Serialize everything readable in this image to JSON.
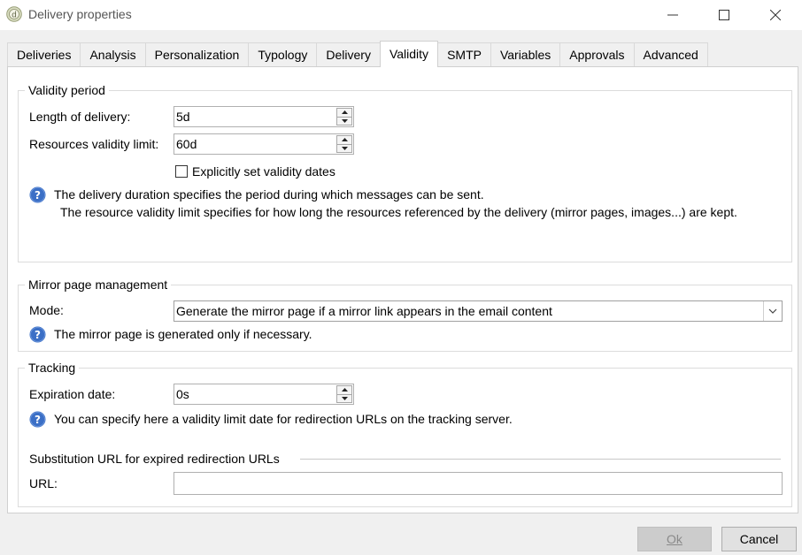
{
  "window": {
    "title": "Delivery properties",
    "app_icon": "delivery-app-icon",
    "controls": [
      "minimize-icon",
      "maximize-icon",
      "close-icon"
    ]
  },
  "tabs": [
    {
      "label": "Deliveries"
    },
    {
      "label": "Analysis"
    },
    {
      "label": "Personalization"
    },
    {
      "label": "Typology"
    },
    {
      "label": "Delivery"
    },
    {
      "label": "Validity",
      "active": true
    },
    {
      "label": "SMTP"
    },
    {
      "label": "Variables"
    },
    {
      "label": "Approvals"
    },
    {
      "label": "Advanced"
    }
  ],
  "validity_period": {
    "title": "Validity period",
    "length_label": "Length of delivery:",
    "length_value": "5d",
    "resources_label": "Resources validity limit:",
    "resources_value": "60d",
    "checkbox_label": "Explicitly set validity dates",
    "checkbox_checked": false,
    "help_line1": "The delivery duration specifies the period during which messages can be sent.",
    "help_line2": "The resource validity limit specifies for how long the resources referenced by the delivery (mirror pages, images...) are kept."
  },
  "mirror_page": {
    "title": "Mirror page management",
    "mode_label": "Mode:",
    "mode_value": "Generate the mirror page if a mirror link appears in the email content",
    "help": "The mirror page is generated only if necessary."
  },
  "tracking": {
    "title": "Tracking",
    "expiration_label": "Expiration date:",
    "expiration_value": "0s",
    "help": "You can specify here a validity limit date for redirection URLs on the tracking server.",
    "substitution_title": "Substitution URL for expired redirection URLs",
    "url_label": "URL:",
    "url_value": ""
  },
  "buttons": {
    "ok_label": "Ok",
    "cancel_label": "Cancel",
    "ok_enabled": false
  },
  "colors": {
    "help_icon": "#3b6fc6",
    "panel_bg": "#ffffff",
    "window_bg": "#f0f0f0"
  }
}
